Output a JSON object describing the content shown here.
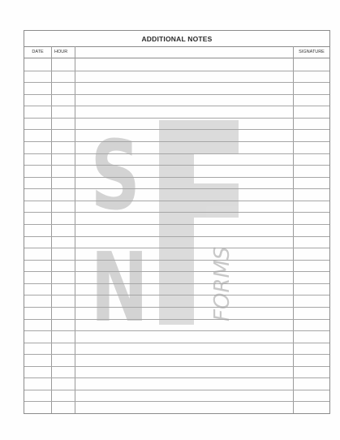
{
  "form": {
    "title": "ADDITIONAL NOTES",
    "columns": {
      "date": "DATE",
      "hour": "HOUR",
      "signature": "SIGNATURE"
    },
    "row_count": 30
  },
  "watermark": {
    "letters": [
      "S",
      "N",
      "F"
    ],
    "word": "FORMS",
    "color": "#d9d9d9"
  }
}
